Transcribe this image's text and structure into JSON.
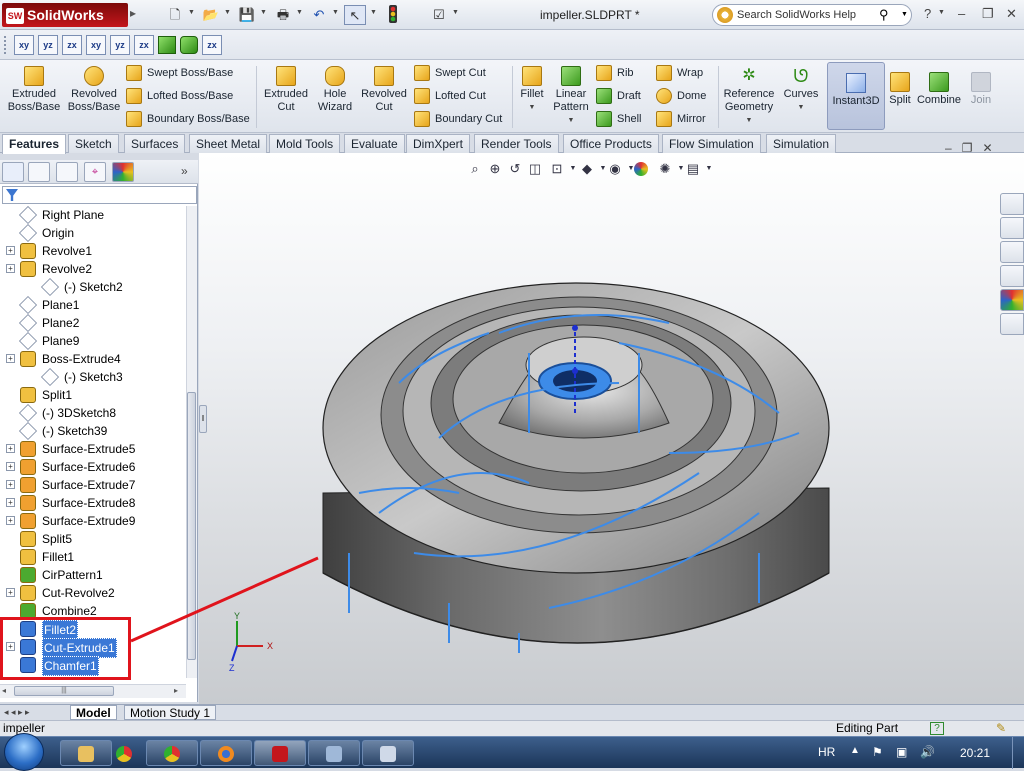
{
  "app": {
    "name": "SolidWorks",
    "document_title": "impeller.SLDPRT *"
  },
  "search": {
    "placeholder": "Search SolidWorks Help"
  },
  "ribbon": {
    "extruded_boss": "Extruded Boss/Base",
    "revolved_boss": "Revolved Boss/Base",
    "swept_boss": "Swept Boss/Base",
    "lofted_boss": "Lofted Boss/Base",
    "boundary_boss": "Boundary Boss/Base",
    "extruded_cut": "Extruded Cut",
    "hole_wizard": "Hole Wizard",
    "revolved_cut": "Revolved Cut",
    "swept_cut": "Swept Cut",
    "lofted_cut": "Lofted Cut",
    "boundary_cut": "Boundary Cut",
    "fillet": "Fillet",
    "linear_pattern": "Linear Pattern",
    "rib": "Rib",
    "draft": "Draft",
    "shell": "Shell",
    "wrap": "Wrap",
    "dome": "Dome",
    "mirror": "Mirror",
    "reference_geometry": "Reference Geometry",
    "curves": "Curves",
    "instant3d": "Instant3D",
    "split": "Split",
    "combine": "Combine",
    "join": "Join"
  },
  "tabs": [
    "Features",
    "Sketch",
    "Surfaces",
    "Sheet Metal",
    "Mold Tools",
    "Evaluate",
    "DimXpert",
    "Render Tools",
    "Office Products",
    "Flow Simulation",
    "Simulation"
  ],
  "tree": [
    {
      "label": "Right Plane",
      "icon": "plane-icon",
      "expand": false,
      "indent": 0
    },
    {
      "label": "Origin",
      "icon": "origin-icon",
      "expand": false,
      "indent": 0
    },
    {
      "label": "Revolve1",
      "icon": "revolve-icon",
      "expand": true,
      "indent": 0
    },
    {
      "label": "Revolve2",
      "icon": "revolve-icon",
      "expand": true,
      "indent": 0
    },
    {
      "label": "(-) Sketch2",
      "icon": "sketch-icon",
      "expand": false,
      "indent": 1
    },
    {
      "label": "Plane1",
      "icon": "plane-icon",
      "expand": false,
      "indent": 0
    },
    {
      "label": "Plane2",
      "icon": "plane-icon",
      "expand": false,
      "indent": 0
    },
    {
      "label": "Plane9",
      "icon": "plane-icon",
      "expand": false,
      "indent": 0
    },
    {
      "label": "Boss-Extrude4",
      "icon": "extrude-icon",
      "expand": true,
      "indent": 0
    },
    {
      "label": "(-) Sketch3",
      "icon": "sketch-icon",
      "expand": false,
      "indent": 1
    },
    {
      "label": "Split1",
      "icon": "split-icon",
      "expand": false,
      "indent": 0
    },
    {
      "label": "(-) 3DSketch8",
      "icon": "3dsketch-icon",
      "expand": false,
      "indent": 0
    },
    {
      "label": "(-) Sketch39",
      "icon": "sketch-icon",
      "expand": false,
      "indent": 0
    },
    {
      "label": "Surface-Extrude5",
      "icon": "surface-icon",
      "expand": true,
      "indent": 0
    },
    {
      "label": "Surface-Extrude6",
      "icon": "surface-icon",
      "expand": true,
      "indent": 0
    },
    {
      "label": "Surface-Extrude7",
      "icon": "surface-icon",
      "expand": true,
      "indent": 0
    },
    {
      "label": "Surface-Extrude8",
      "icon": "surface-icon",
      "expand": true,
      "indent": 0
    },
    {
      "label": "Surface-Extrude9",
      "icon": "surface-icon",
      "expand": true,
      "indent": 0
    },
    {
      "label": "Split5",
      "icon": "split-icon",
      "expand": false,
      "indent": 0
    },
    {
      "label": "Fillet1",
      "icon": "fillet-icon",
      "expand": false,
      "indent": 0
    },
    {
      "label": "CirPattern1",
      "icon": "pattern-icon",
      "expand": false,
      "indent": 0
    },
    {
      "label": "Cut-Revolve2",
      "icon": "cut-icon",
      "expand": true,
      "indent": 0
    },
    {
      "label": "Combine2",
      "icon": "combine-icon",
      "expand": false,
      "indent": 0
    },
    {
      "label": "Fillet2",
      "icon": "fillet-icon",
      "expand": false,
      "indent": 0,
      "selected": true
    },
    {
      "label": "Cut-Extrude1",
      "icon": "cut-icon",
      "expand": true,
      "indent": 0,
      "selected": true
    },
    {
      "label": "Chamfer1",
      "icon": "chamfer-icon",
      "expand": false,
      "indent": 0,
      "selected": true
    }
  ],
  "bottom_tabs": {
    "model": "Model",
    "motion": "Motion Study 1"
  },
  "status": {
    "left": "impeller",
    "right": "Editing Part"
  },
  "taskbar": {
    "lang": "HR",
    "time": "20:21"
  },
  "triad": {
    "x": "X",
    "y": "Y",
    "z": "Z"
  },
  "colors": {
    "accent": "#3a78d6",
    "highlight_box": "#e0141c",
    "edge_blue": "#3d8be8"
  }
}
